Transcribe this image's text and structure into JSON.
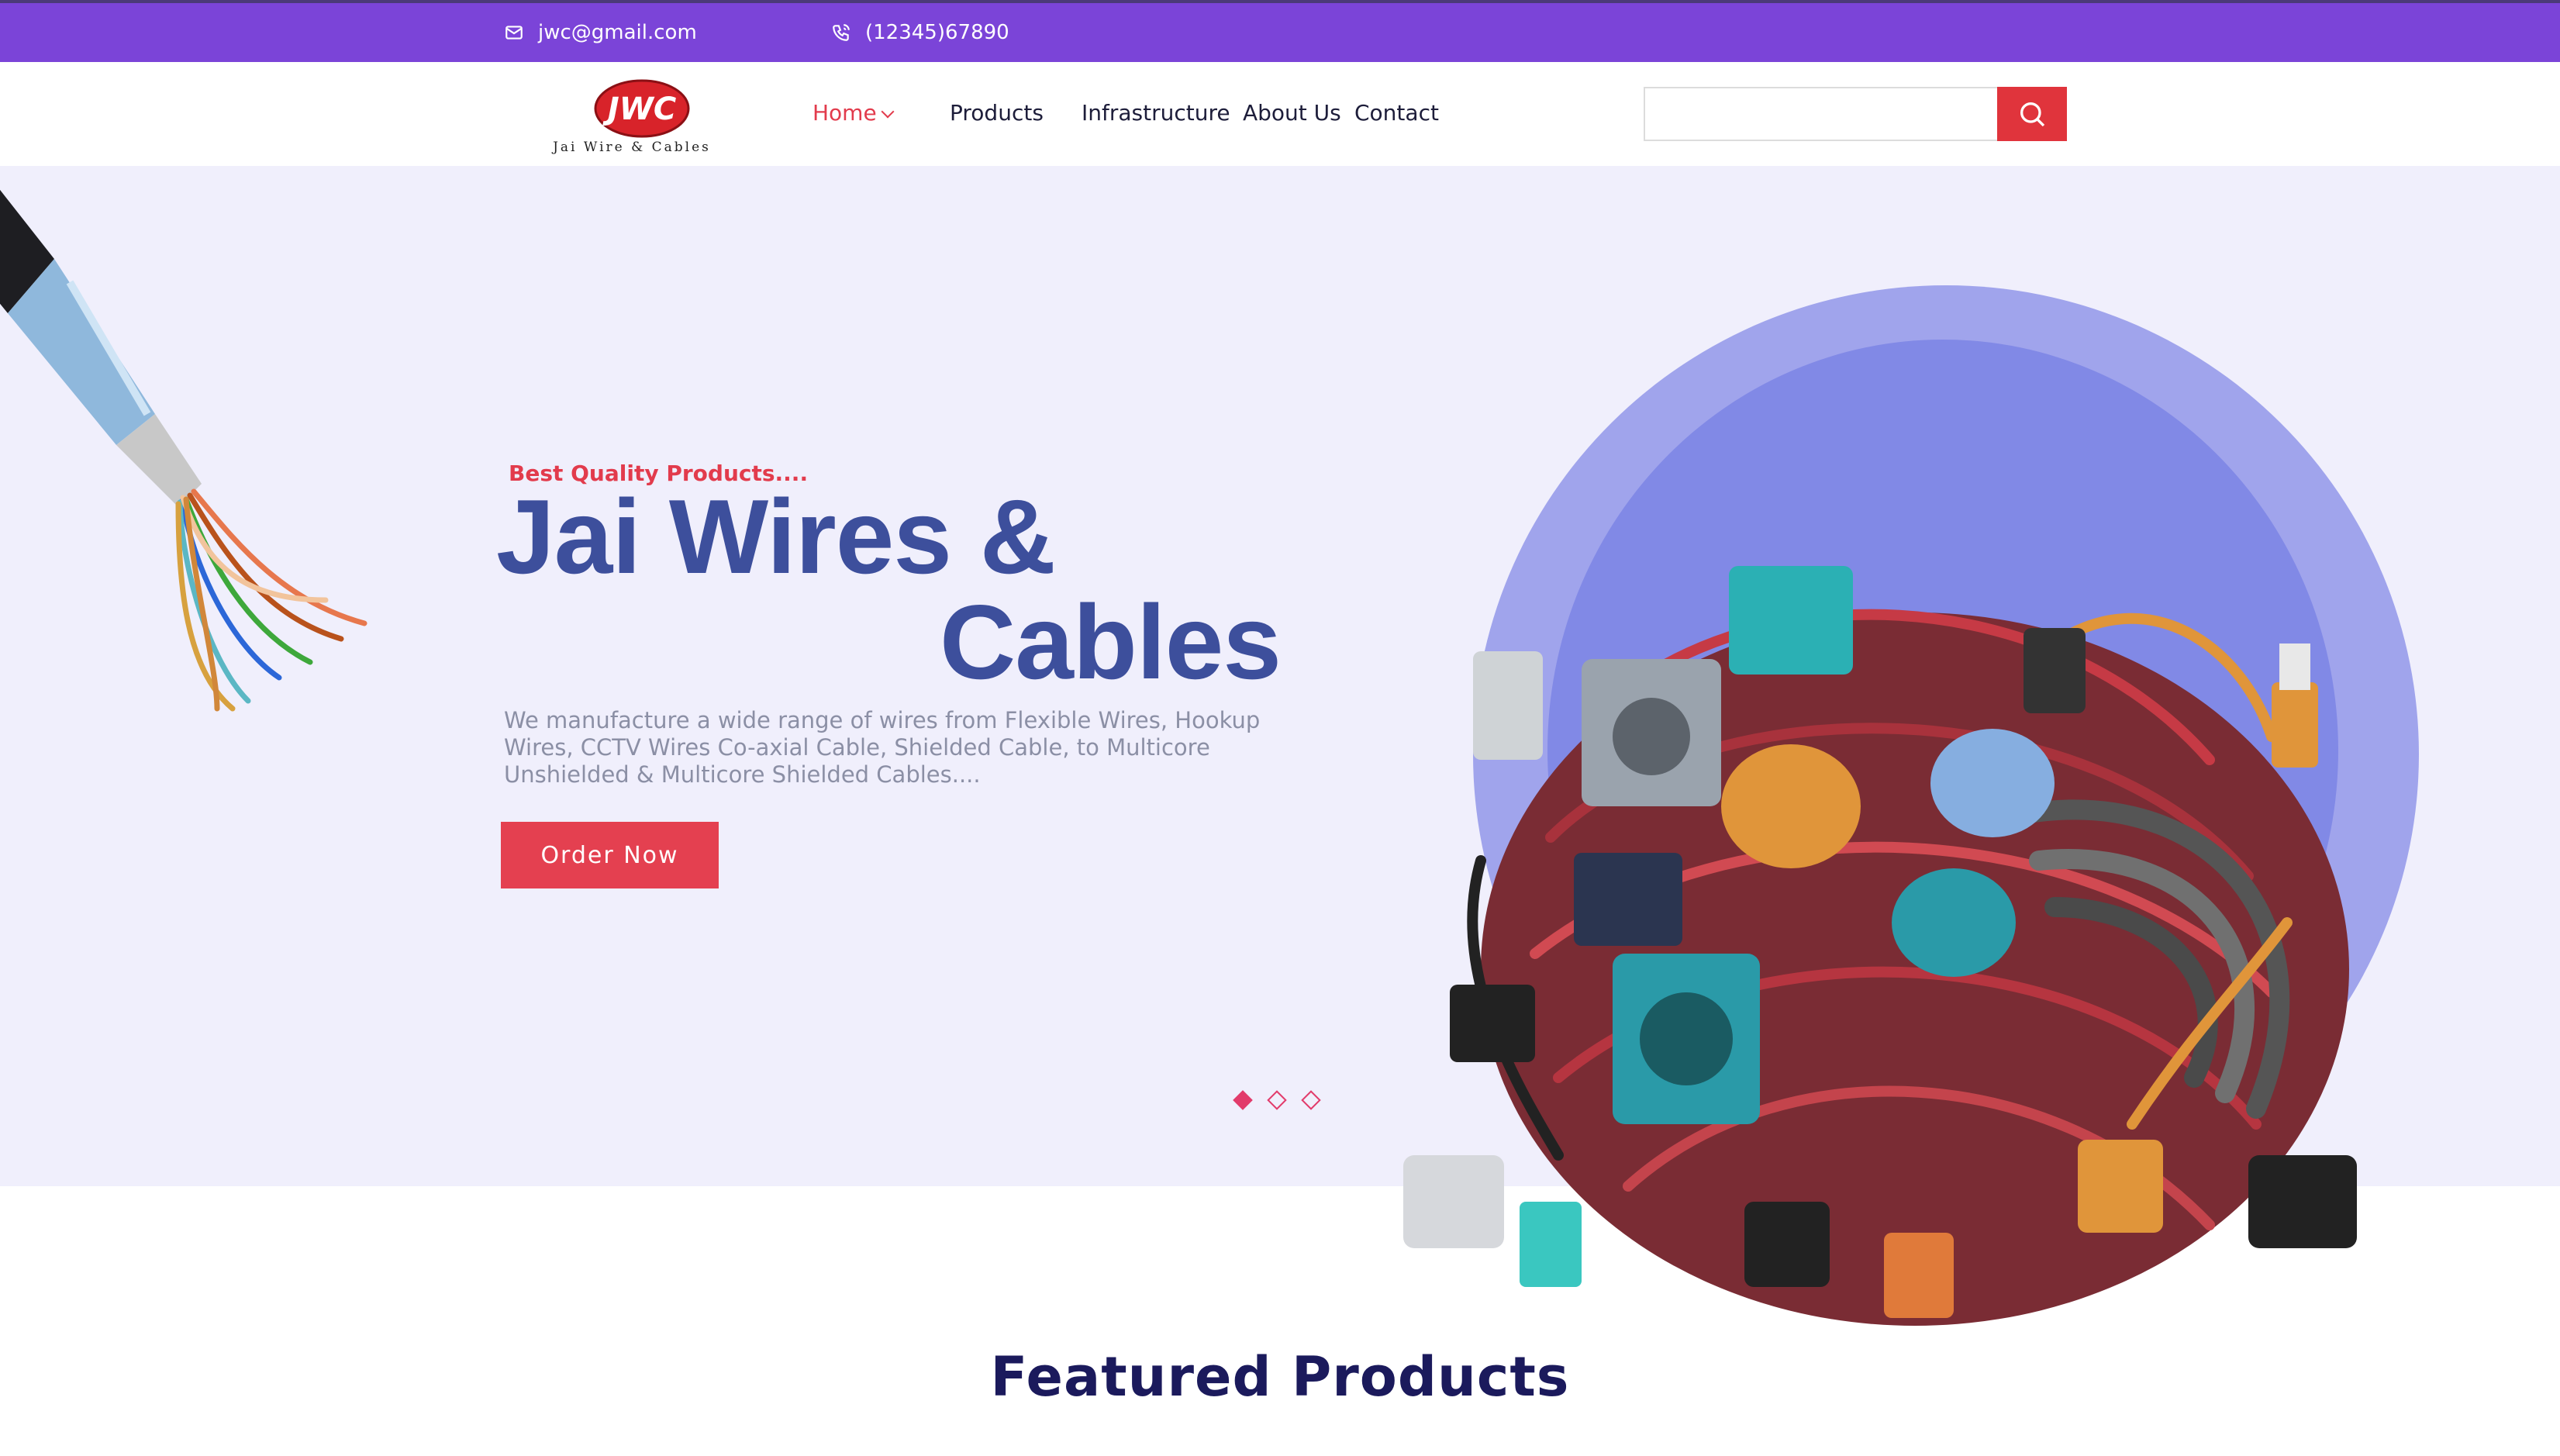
{
  "topbar": {
    "email": "jwc@gmail.com",
    "phone": "(12345)67890"
  },
  "logo": {
    "text": "JWC",
    "tagline": "Jai Wire & Cables"
  },
  "nav": {
    "home": "Home",
    "products": "Products",
    "infrastructure": "Infrastructure",
    "about": "About Us",
    "contact": "Contact"
  },
  "search": {
    "placeholder": ""
  },
  "hero": {
    "kicker": "Best Quality Products....",
    "title_line1": "Jai Wires &",
    "title_line2": "Cables",
    "description": "We manufacture a wide range of wires from Flexible Wires, Hookup Wires, CCTV Wires Co-axial Cable, Shielded Cable, to Multicore Unshielded & Multicore Shielded Cables....",
    "cta": "Order Now",
    "slides": 3,
    "active_slide": 1
  },
  "section": {
    "featured_title": "Featured Products"
  },
  "colors": {
    "topbar": "#7b44d8",
    "accent": "#e23b4c",
    "title": "#3d4f9c",
    "hero_bg": "#f0effc"
  }
}
